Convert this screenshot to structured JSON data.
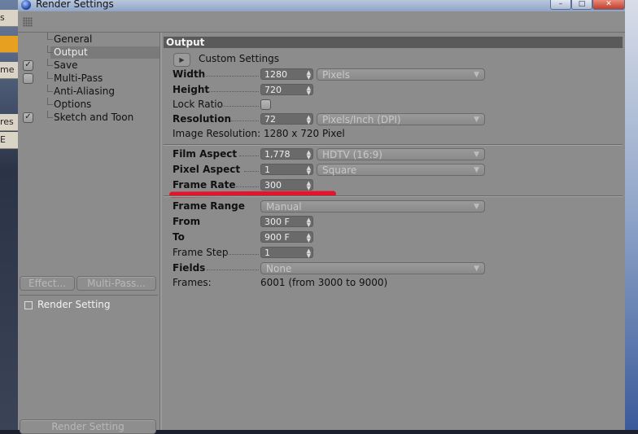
{
  "window": {
    "title": "Render Settings"
  },
  "background": {
    "left_items": [
      "s",
      "",
      "me",
      "",
      "res",
      "E"
    ]
  },
  "nav": {
    "items": [
      {
        "label": "General",
        "checkbox": false,
        "checked": false
      },
      {
        "label": "Output",
        "checkbox": false,
        "checked": false,
        "selected": true
      },
      {
        "label": "Save",
        "checkbox": true,
        "checked": true
      },
      {
        "label": "Multi-Pass",
        "checkbox": true,
        "checked": false
      },
      {
        "label": "Anti-Aliasing",
        "checkbox": false,
        "checked": false
      },
      {
        "label": "Options",
        "checkbox": false,
        "checked": false
      },
      {
        "label": "Sketch and Toon",
        "checkbox": true,
        "checked": true
      }
    ],
    "effect_button": "Effect...",
    "multipass_button": "Multi-Pass...",
    "render_setting_item": "Render Setting",
    "render_setting_button": "Render Setting"
  },
  "output": {
    "section_title": "Output",
    "custom_settings": "Custom Settings",
    "width": {
      "label": "Width",
      "value": "1280",
      "unit": "Pixels"
    },
    "height": {
      "label": "Height",
      "value": "720"
    },
    "lock_ratio": {
      "label": "Lock Ratio"
    },
    "resolution": {
      "label": "Resolution",
      "value": "72",
      "unit": "Pixels/Inch (DPI)"
    },
    "image_resolution": "Image Resolution: 1280 x 720 Pixel",
    "film_aspect": {
      "label": "Film Aspect",
      "value": "1,778",
      "preset": "HDTV (16:9)"
    },
    "pixel_aspect": {
      "label": "Pixel Aspect",
      "value": "1",
      "preset": "Square"
    },
    "frame_rate": {
      "label": "Frame Rate",
      "value": "300"
    },
    "frame_range": {
      "label": "Frame Range",
      "value": "Manual"
    },
    "from": {
      "label": "From",
      "value": "300 F"
    },
    "to": {
      "label": "To",
      "value": "900 F"
    },
    "frame_step": {
      "label": "Frame Step",
      "value": "1"
    },
    "fields": {
      "label": "Fields",
      "value": "None"
    },
    "frames": {
      "label": "Frames:",
      "value": "6001 (from 3000 to 9000)"
    }
  },
  "colors": {
    "annotation": "#e3142c",
    "panel": "#8c8c8c",
    "header": "#5a5a5a"
  }
}
